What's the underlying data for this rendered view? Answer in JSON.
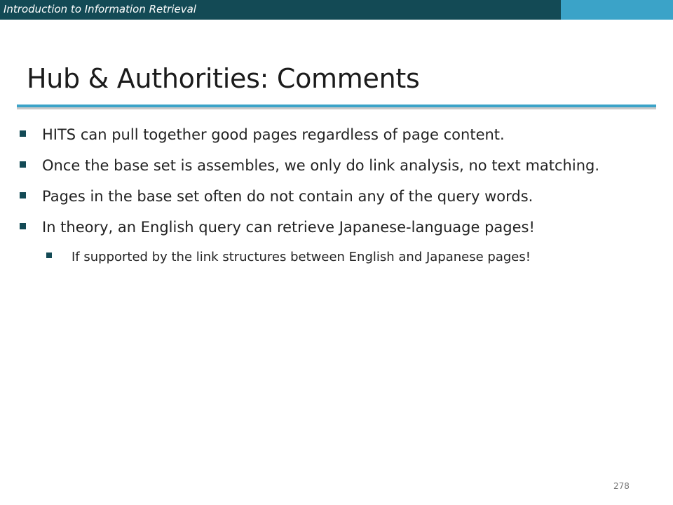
{
  "header": {
    "course_title": "Introduction to Information Retrieval"
  },
  "slide": {
    "title": "Hub & Authorities: Comments",
    "bullets": [
      {
        "level": 1,
        "text": "HITS can pull together good pages regardless of page content."
      },
      {
        "level": 1,
        "text": "Once the base set is assembles, we only do link analysis, no text matching."
      },
      {
        "level": 1,
        "text": "Pages in the base set often do not contain any of the query words."
      },
      {
        "level": 1,
        "text": "In theory, an English query can retrieve Japanese-language pages!"
      },
      {
        "level": 2,
        "text": "If supported by the link structures between English and Japanese pages!"
      }
    ],
    "page_number": "278"
  },
  "colors": {
    "header_bar": "#134a55",
    "accent": "#3ba3c8",
    "bullet": "#134a55"
  }
}
